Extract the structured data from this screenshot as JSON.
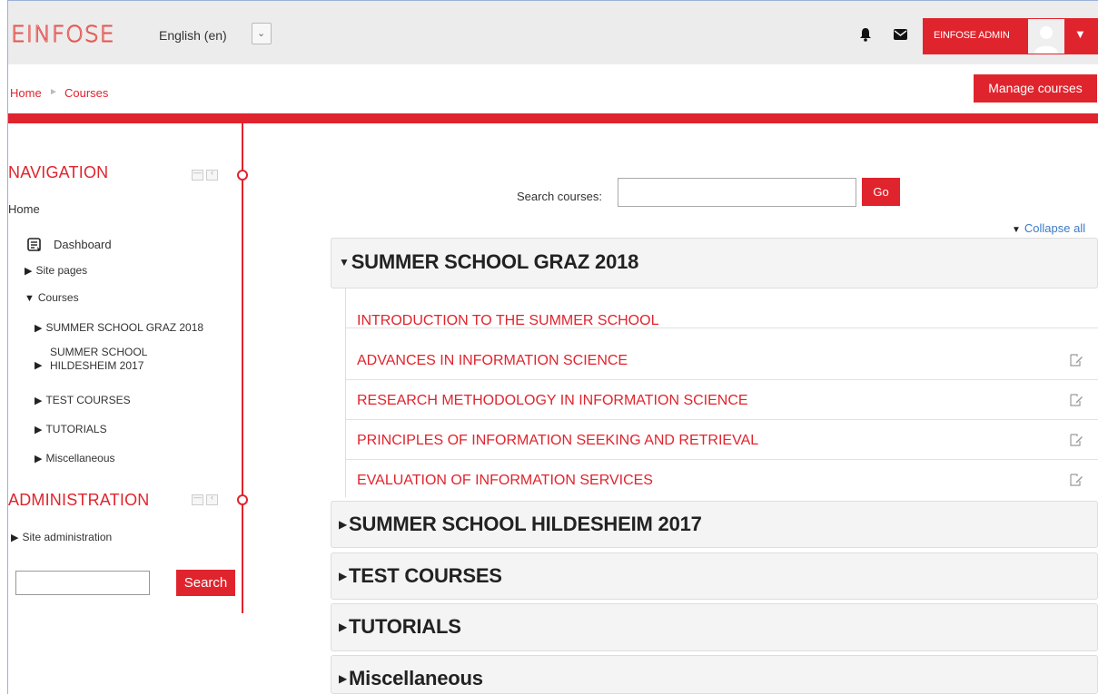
{
  "header": {
    "logo_text": "EINFOSE",
    "language": "English (en)",
    "language_caret": "⌄",
    "user_name": "EINFOSE ADMIN",
    "user_caret": "▼"
  },
  "breadcrumb": {
    "home": "Home",
    "separator": "►",
    "courses": "Courses"
  },
  "manage_courses_label": "Manage courses",
  "sidebar": {
    "navigation_title": "NAVIGATION",
    "home": "Home",
    "dashboard": "Dashboard",
    "site_pages": "Site pages",
    "courses": "Courses",
    "course_items": [
      "SUMMER SCHOOL GRAZ 2018",
      "SUMMER SCHOOL",
      "HILDESHEIM 2017",
      "TEST COURSES",
      "TUTORIALS",
      "Miscellaneous"
    ],
    "administration_title": "ADMINISTRATION",
    "site_administration": "Site administration",
    "search_button": "Search"
  },
  "main": {
    "search_label": "Search courses:",
    "go_label": "Go",
    "collapse_all": "Collapse all",
    "expanded_category": "SUMMER SCHOOL GRAZ 2018",
    "courses": [
      "INTRODUCTION TO THE SUMMER SCHOOL",
      "ADVANCES IN INFORMATION SCIENCE",
      "RESEARCH METHODOLOGY IN INFORMATION SCIENCE",
      "PRINCIPLES OF INFORMATION SEEKING AND RETRIEVAL",
      "EVALUATION OF INFORMATION SERVICES"
    ],
    "collapsed_categories": [
      "SUMMER SCHOOL HILDESHEIM 2017",
      "TEST COURSES",
      "TUTORIALS",
      "Miscellaneous"
    ]
  },
  "colors": {
    "accent": "#e0242d",
    "link": "#3a7ac8"
  },
  "icons": [
    "bell-icon",
    "mail-icon",
    "avatar",
    "dashboard-icon",
    "summary-icon"
  ]
}
